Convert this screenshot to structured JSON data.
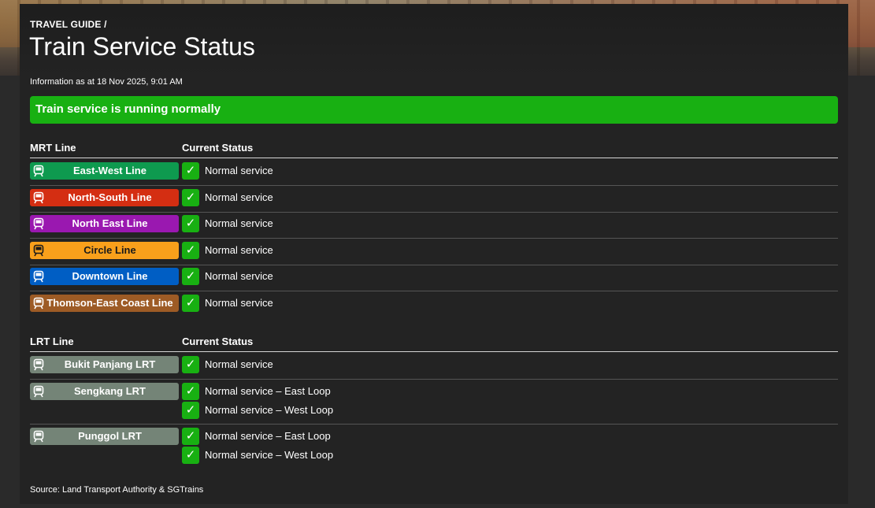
{
  "header": {
    "breadcrumb": "TRAVEL GUIDE /",
    "title": "Train Service Status"
  },
  "info_text": "Information as at 18 Nov 2025, 9:01 AM",
  "overall_status": "Train service is running normally",
  "mrt": {
    "header_line": "MRT Line",
    "header_status": "Current Status",
    "lines": [
      {
        "name": "East-West Line",
        "color": "#0e9a4f",
        "text_color": "#ffffff",
        "status": "Normal service"
      },
      {
        "name": "North-South Line",
        "color": "#d42e12",
        "text_color": "#ffffff",
        "status": "Normal service"
      },
      {
        "name": "North East Line",
        "color": "#9a18b0",
        "text_color": "#ffffff",
        "status": "Normal service"
      },
      {
        "name": "Circle Line",
        "color": "#f9a01b",
        "text_color": "#1a1a1a",
        "status": "Normal service"
      },
      {
        "name": "Downtown Line",
        "color": "#005ec4",
        "text_color": "#ffffff",
        "status": "Normal service"
      },
      {
        "name": "Thomson-East Coast Line",
        "color": "#9d5b25",
        "text_color": "#ffffff",
        "status": "Normal service"
      }
    ]
  },
  "lrt": {
    "header_line": "LRT Line",
    "header_status": "Current Status",
    "lines": [
      {
        "name": "Bukit Panjang LRT",
        "color": "#748477",
        "text_color": "#ffffff",
        "statuses": [
          "Normal service"
        ]
      },
      {
        "name": "Sengkang LRT",
        "color": "#748477",
        "text_color": "#ffffff",
        "statuses": [
          "Normal service – East Loop",
          "Normal service – West Loop"
        ]
      },
      {
        "name": "Punggol LRT",
        "color": "#748477",
        "text_color": "#ffffff",
        "statuses": [
          "Normal service – East Loop",
          "Normal service – West Loop"
        ]
      }
    ]
  },
  "icons": {
    "train": "train-icon",
    "check": "check-icon",
    "check_glyph": "✓"
  },
  "status_ok_color": "#18b012",
  "source": "Source: Land Transport Authority & SGTrains"
}
